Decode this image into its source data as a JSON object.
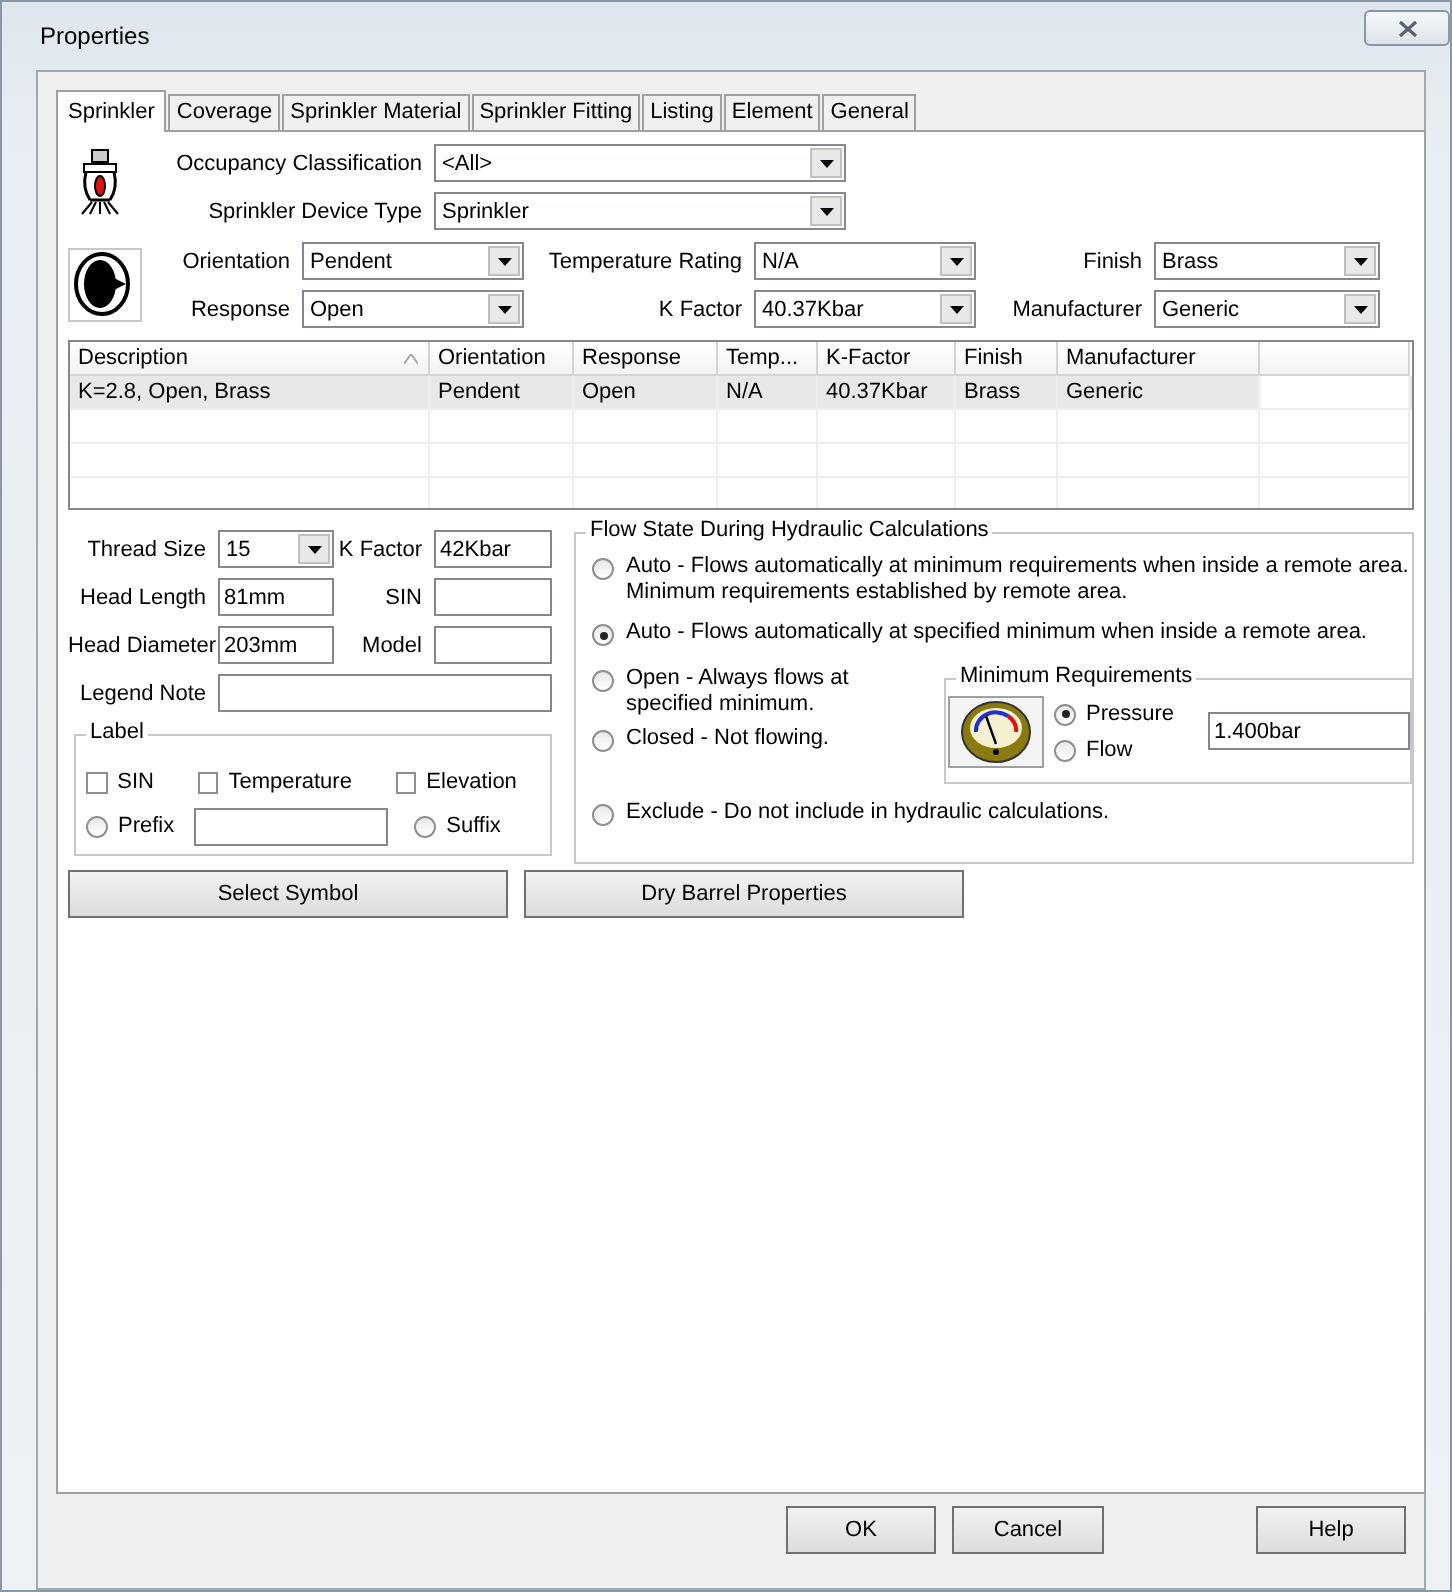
{
  "window": {
    "title": "Properties"
  },
  "tabs": [
    {
      "label": "Sprinkler",
      "selected": true
    },
    {
      "label": "Coverage",
      "selected": false
    },
    {
      "label": "Sprinkler Material",
      "selected": false
    },
    {
      "label": "Sprinkler Fitting",
      "selected": false
    },
    {
      "label": "Listing",
      "selected": false
    },
    {
      "label": "Element",
      "selected": false
    },
    {
      "label": "General",
      "selected": false
    }
  ],
  "device": [
    {
      "label": "Occupancy Classification",
      "value": "<All>"
    },
    {
      "label": "Sprinkler Device Type",
      "value": "Sprinkler"
    }
  ],
  "selectors": [
    {
      "label": "Orientation",
      "value": "Pendent"
    },
    {
      "label": "Temperature Rating",
      "value": "N/A"
    },
    {
      "label": "Finish",
      "value": "Brass"
    },
    {
      "label": "Response",
      "value": "Open"
    },
    {
      "label": "K Factor",
      "value": "40.37Kbar"
    },
    {
      "label": "Manufacturer",
      "value": "Generic"
    }
  ],
  "table": {
    "columns": [
      "Description",
      "Orientation",
      "Response",
      "Temp...",
      "K-Factor",
      "Finish",
      "Manufacturer"
    ],
    "rows": [
      {
        "cells": [
          "K=2.8, Open, Brass",
          "Pendent",
          "Open",
          "N/A",
          "40.37Kbar",
          "Brass",
          "Generic"
        ],
        "selected": true
      }
    ]
  },
  "details": [
    {
      "kind": "dropdown",
      "label": "Thread Size",
      "value": "15"
    },
    {
      "kind": "text",
      "label": "K Factor",
      "value": "42Kbar"
    },
    {
      "kind": "text",
      "label": "Head Length",
      "value": "81mm"
    },
    {
      "kind": "text",
      "label": "SIN"
    },
    {
      "kind": "text",
      "label": "Head Diameter",
      "value": "203mm"
    },
    {
      "kind": "text",
      "label": "Model"
    }
  ],
  "legend_note": {
    "label": "Legend Note"
  },
  "label_group": {
    "title": "Label",
    "checkboxes": [
      {
        "label": "SIN",
        "checked": false
      },
      {
        "label": "Temperature",
        "checked": false
      },
      {
        "label": "Elevation",
        "checked": false
      }
    ],
    "radios": [
      {
        "label": "Prefix",
        "selected": false
      },
      {
        "label": "Suffix",
        "selected": false
      }
    ]
  },
  "flow_state": {
    "title": "Flow State During Hydraulic Calculations",
    "options": [
      {
        "label": "Auto - Flows automatically at minimum requirements when inside a remote area.",
        "note": "Minimum requirements established by remote area.",
        "selected": false
      },
      {
        "label": "Auto - Flows automatically at specified minimum when inside a remote area.",
        "selected": true
      },
      {
        "label": "Open - Always flows at",
        "note": "specified minimum.",
        "selected": false
      },
      {
        "label": "Closed - Not flowing.",
        "selected": false
      },
      {
        "label": "Exclude - Do not include in hydraulic calculations.",
        "selected": false
      }
    ],
    "minimum": {
      "title": "Minimum Requirements",
      "radios": [
        {
          "label": "Pressure",
          "selected": true
        },
        {
          "label": "Flow",
          "selected": false
        }
      ],
      "value": "1.400bar"
    }
  },
  "panel_buttons": [
    "Select Symbol",
    "Dry Barrel Properties"
  ],
  "dialog_buttons": [
    "OK",
    "Cancel",
    "Help"
  ]
}
